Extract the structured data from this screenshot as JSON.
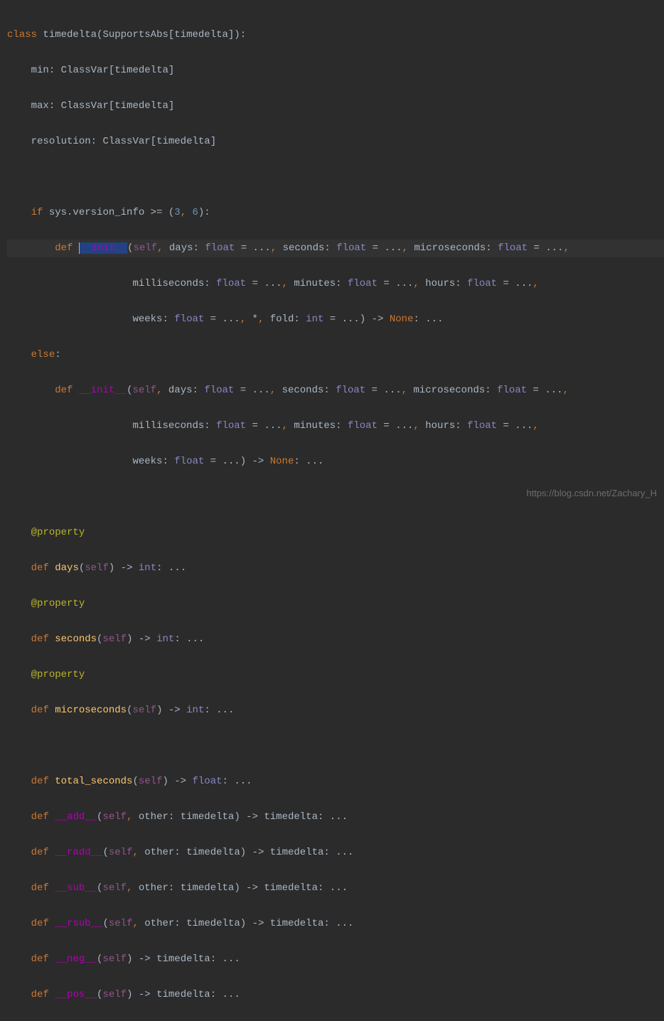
{
  "code": {
    "class_kw": "class",
    "class_name": "timedelta",
    "supports_abs": "SupportsAbs",
    "min_line": {
      "name": "min",
      "type": "ClassVar",
      "inner": "timedelta"
    },
    "max_line": {
      "name": "max",
      "type": "ClassVar",
      "inner": "timedelta"
    },
    "resolution_line": {
      "name": "resolution",
      "type": "ClassVar",
      "inner": "timedelta"
    },
    "if_kw": "if",
    "sys_version": "sys.version_info",
    "gte": ">=",
    "tuple_3": "3",
    "tuple_6": "6",
    "def_kw": "def",
    "init": "__init__",
    "self": "self",
    "days": "days",
    "seconds": "seconds",
    "microseconds": "microseconds",
    "milliseconds": "milliseconds",
    "minutes": "minutes",
    "hours": "hours",
    "weeks": "weeks",
    "fold": "fold",
    "float": "float",
    "int": "int",
    "none": "None",
    "else_kw": "else",
    "property_dec": "@property",
    "days_method": "days",
    "seconds_method": "seconds",
    "microseconds_method": "microseconds",
    "total_seconds": "total_seconds",
    "add": "__add__",
    "radd": "__radd__",
    "sub": "__sub__",
    "rsub": "__rsub__",
    "neg": "__neg__",
    "pos": "__pos__",
    "other": "other",
    "timedelta": "timedelta",
    "star": "*",
    "arrow": "->",
    "ellipsis": "..."
  },
  "watermark": "https://blog.csdn.net/Zachary_H"
}
